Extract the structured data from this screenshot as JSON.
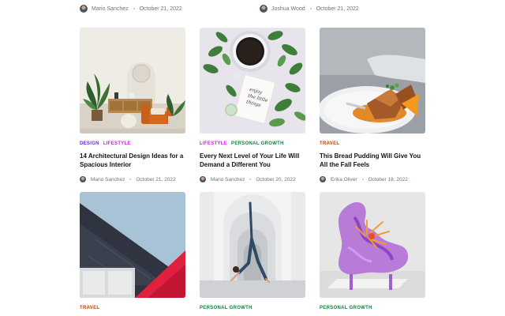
{
  "top_meta": [
    {
      "author": "Mario Sanchez",
      "date": "October 21, 2022"
    },
    {
      "author": "Joshua Wood",
      "date": "October 21, 2022"
    }
  ],
  "cards": [
    {
      "tags": [
        "DESIGN",
        "LIFESTYLE"
      ],
      "title": "14 Architectural Design Ideas for a Spacious Interior",
      "author": "Mario Sanchez",
      "date": "October 21, 2022"
    },
    {
      "tags": [
        "LIFESTYLE",
        "PERSONAL GROWTH"
      ],
      "title": "Every Next Level of Your Life Will Demand a Different You",
      "author": "Mario Sanchez",
      "date": "October 20, 2022"
    },
    {
      "tags": [
        "TRAVEL"
      ],
      "title": "This Bread Pudding Will Give You All the Fall Feels",
      "author": "Erika Oliver",
      "date": "October 18, 2022"
    },
    {
      "tags": [
        "TRAVEL"
      ]
    },
    {
      "tags": [
        "PERSONAL GROWTH"
      ]
    },
    {
      "tags": [
        "PERSONAL GROWTH"
      ]
    }
  ],
  "images": {
    "card2_note": "enjoy the little things"
  }
}
